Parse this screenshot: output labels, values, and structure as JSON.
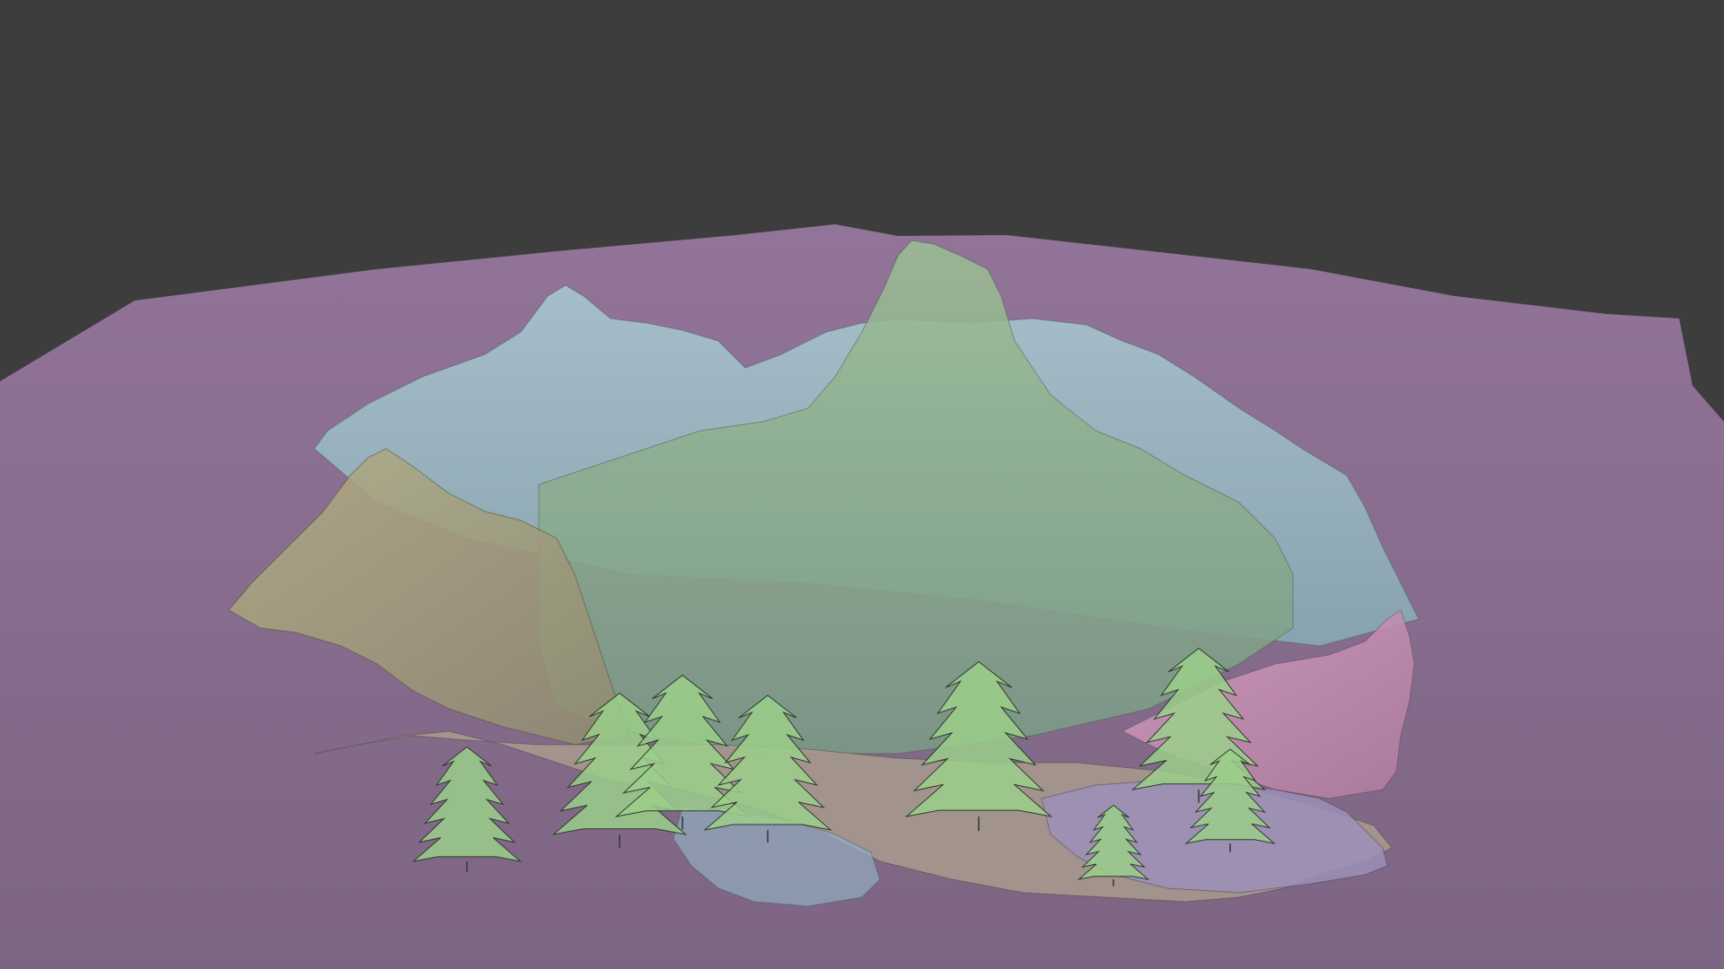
{
  "viewport": {
    "background_color": "#3d3d3d"
  },
  "scene": {
    "ground_plane_color": "#8f7196",
    "layer_colors": {
      "blue_range": "#95b8c2",
      "green_peak": "#86a88b",
      "yellow_hill": "#a8a27e",
      "pink_ridge": "#c890b4",
      "violet_cliff": "#9b8fb8",
      "tree_foliage": "#9bcf8a",
      "tree_outline": "#2f3a2e"
    },
    "objects": [
      {
        "name": "ground-plane",
        "label": ""
      },
      {
        "name": "blue-mountain-range",
        "label": ""
      },
      {
        "name": "green-mountain-peak",
        "label": ""
      },
      {
        "name": "yellow-hill",
        "label": ""
      },
      {
        "name": "pink-ridge",
        "label": ""
      },
      {
        "name": "violet-cliff",
        "label": ""
      },
      {
        "name": "tree-cluster",
        "label": ""
      }
    ]
  }
}
